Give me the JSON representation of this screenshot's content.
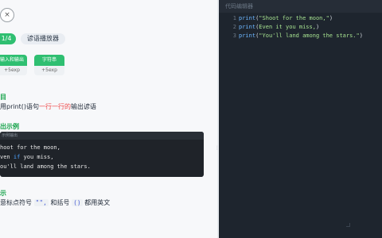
{
  "left": {
    "close_glyph": "×",
    "progress": "1/4",
    "lesson_tag": "谚语播放器",
    "rewards": [
      {
        "label": "输入和输出",
        "exp": "+5exp"
      },
      {
        "label": "字符串",
        "exp": "+5exp"
      }
    ],
    "task_title": "目",
    "task_text_pre": "用print()语句",
    "task_text_hl": "一行一行的",
    "task_text_post": "输出谚语",
    "example_title": "出示例",
    "example_header": "示例输出",
    "example_lines": [
      {
        "pre": "hoot for the moon,",
        "kw": "",
        "post": ""
      },
      {
        "pre": "ven ",
        "kw": "if",
        "post": " you miss,"
      },
      {
        "pre": "ou'll land among the stars.",
        "kw": "",
        "post": ""
      }
    ],
    "tip_title": "示",
    "tip_pre": "意标点符号 ",
    "tip_code1": "\"\",",
    "tip_mid": " 和括号 ",
    "tip_code2": "()",
    "tip_post": " 都用英文"
  },
  "editor": {
    "title": "代码编辑器",
    "lines": [
      {
        "num": "1",
        "fn": "print",
        "arg": "\"Shoot for the moon,\""
      },
      {
        "num": "2",
        "fn": "print",
        "arg": "Even it you miss,"
      },
      {
        "num": "3",
        "fn": "print",
        "arg": "\"You'll land among the stars.\""
      }
    ]
  }
}
